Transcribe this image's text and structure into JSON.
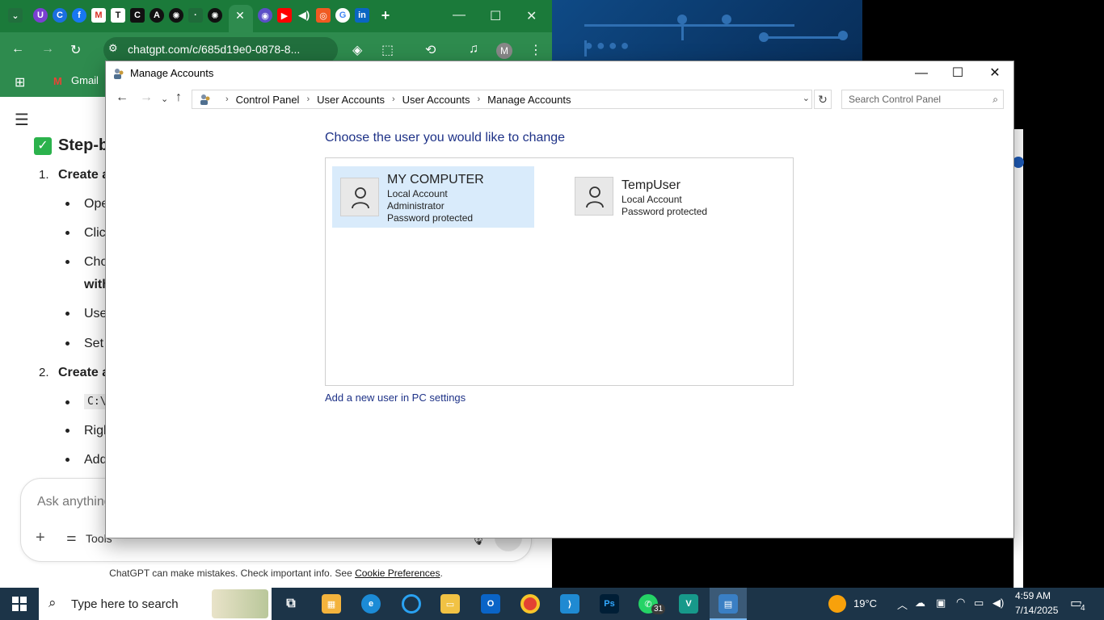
{
  "chrome": {
    "url": "chatgpt.com/c/685d19e0-0878-8...",
    "bookmark_gmail": "Gmail",
    "avatar_letter": "M",
    "chat": {
      "heading": "Step-b",
      "item1": "Create a",
      "b1": "Ope",
      "b2": "Clic",
      "b3": "Cho",
      "b3b": "with",
      "b4": "Use",
      "b5": "Set",
      "item2": "Create a",
      "b6": "C:\\",
      "b7": "Righ",
      "b8": "Add",
      "ask_placeholder": "Ask anything",
      "tools_label": "Tools",
      "footer_text": "ChatGPT can make mistakes. Check important info. See ",
      "footer_link": "Cookie Preferences",
      "footer_end": "."
    }
  },
  "window": {
    "title": "Manage Accounts",
    "breadcrumb": [
      "Control Panel",
      "User Accounts",
      "User Accounts",
      "Manage Accounts"
    ],
    "search_placeholder": "Search Control Panel",
    "heading": "Choose the user you would like to change",
    "accounts": [
      {
        "name": "MY COMPUTER",
        "lines": [
          "Local Account",
          "Administrator",
          "Password protected"
        ],
        "selected": true
      },
      {
        "name": "TempUser",
        "lines": [
          "Local Account",
          "Password protected"
        ],
        "selected": false
      }
    ],
    "add_user_link": "Add a new user in PC settings"
  },
  "taskbar": {
    "search_text": "Type here to search",
    "weather": "19°C",
    "time": "4:59 AM",
    "date": "7/14/2025",
    "notification_count": "4",
    "whatsapp_badge": "31"
  },
  "colors": {
    "chrome_accent": "#2e8b4e",
    "link_blue": "#1e3287",
    "selected_account": "#d9ebfb",
    "taskbar": "#1c3448"
  }
}
